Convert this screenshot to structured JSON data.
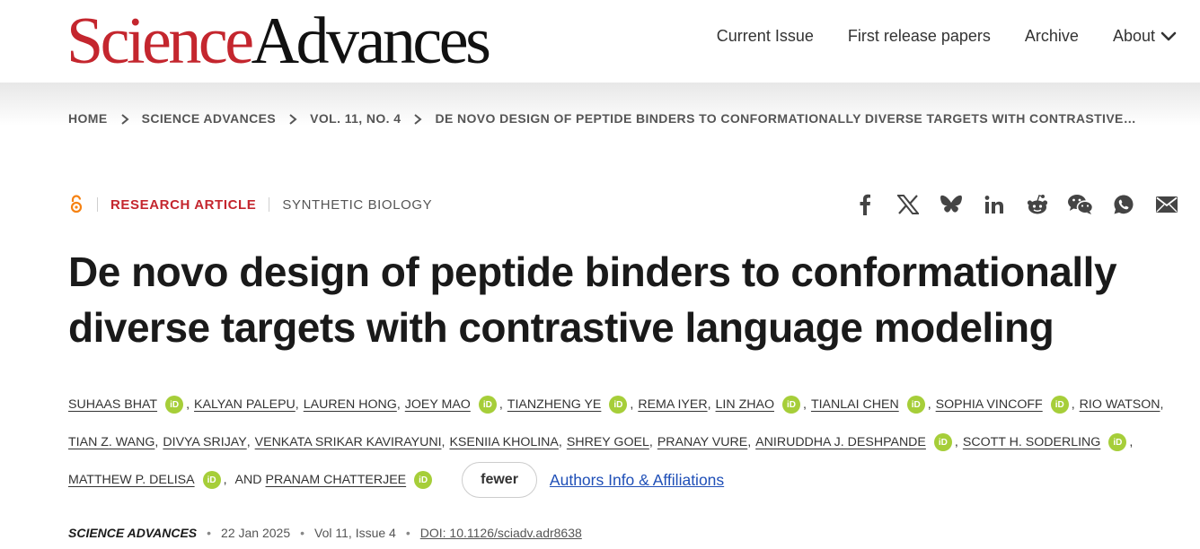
{
  "header": {
    "logo": {
      "science": "Science",
      "advances": "Advances"
    },
    "nav": [
      {
        "label": "Current Issue"
      },
      {
        "label": "First release papers"
      },
      {
        "label": "Archive"
      },
      {
        "label": "About",
        "icon": "chevron-down-icon"
      }
    ]
  },
  "breadcrumb": [
    "HOME",
    "SCIENCE ADVANCES",
    "VOL. 11, NO. 4",
    "DE NOVO DESIGN OF PEPTIDE BINDERS TO CONFORMATIONALLY DIVERSE TARGETS WITH CONTRASTIVE…"
  ],
  "article": {
    "access_icon": "open-access-icon",
    "type": "RESEARCH ARTICLE",
    "subject": "SYNTHETIC BIOLOGY",
    "title": "De novo design of peptide binders to conformationally diverse targets with contrastive language modeling",
    "authors": [
      {
        "name": "SUHAAS BHAT",
        "orcid": true
      },
      {
        "name": "KALYAN PALEPU",
        "orcid": false
      },
      {
        "name": "LAUREN HONG",
        "orcid": false
      },
      {
        "name": "JOEY MAO",
        "orcid": true
      },
      {
        "name": "TIANZHENG YE",
        "orcid": true
      },
      {
        "name": "REMA IYER",
        "orcid": false
      },
      {
        "name": "LIN ZHAO",
        "orcid": true
      },
      {
        "name": "TIANLAI CHEN",
        "orcid": true
      },
      {
        "name": "SOPHIA VINCOFF",
        "orcid": true
      },
      {
        "name": "RIO WATSON",
        "orcid": false
      },
      {
        "name": "TIAN Z. WANG",
        "orcid": false
      },
      {
        "name": "DIVYA SRIJAY",
        "orcid": false
      },
      {
        "name": "VENKATA SRIKAR KAVIRAYUNI",
        "orcid": false
      },
      {
        "name": "KSENIIA KHOLINA",
        "orcid": false
      },
      {
        "name": "SHREY GOEL",
        "orcid": false
      },
      {
        "name": "PRANAY VURE",
        "orcid": false
      },
      {
        "name": "ANIRUDDHA J. DESHPANDE",
        "orcid": true
      },
      {
        "name": "SCOTT H. SODERLING",
        "orcid": true
      },
      {
        "name": "MATTHEW P. DELISA",
        "orcid": true
      },
      {
        "name": "PRANAM CHATTERJEE",
        "orcid": true
      }
    ],
    "and_label": "AND",
    "orcid_label": "iD",
    "fewer_label": "fewer",
    "affiliations_label": "Authors Info & Affiliations",
    "citation": {
      "journal": "SCIENCE ADVANCES",
      "date": "22 Jan 2025",
      "volume_issue": "Vol 11, Issue 4",
      "doi": "DOI: 10.1126/sciadv.adr8638"
    }
  },
  "share_icons": [
    "facebook-icon",
    "x-icon",
    "bluesky-icon",
    "linkedin-icon",
    "reddit-icon",
    "wechat-icon",
    "whatsapp-icon",
    "email-icon"
  ],
  "colors": {
    "brand_red": "#c4262e",
    "orcid_green": "#a6ce39",
    "link_blue": "#1f4fb7",
    "open_access_orange": "#f68212"
  }
}
